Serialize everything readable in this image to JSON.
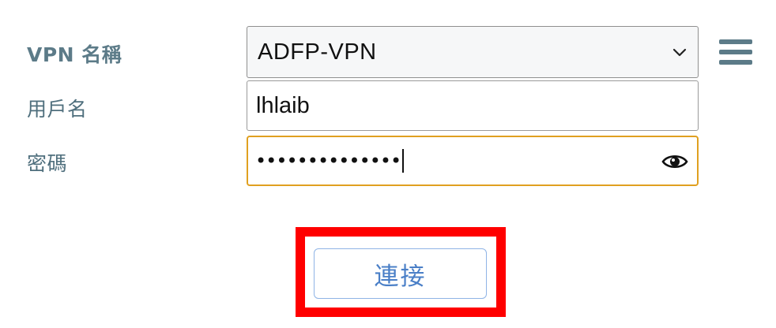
{
  "form": {
    "vpn_name_label": "VPN 名稱",
    "username_label": "用戶名",
    "password_label": "密碼",
    "vpn_name_value": "ADFP-VPN",
    "username_value": "lhlaib",
    "password_masked": "••••••••••••••"
  },
  "actions": {
    "connect_label": "連接",
    "menu_icon": "hamburger-menu-icon",
    "toggle_visibility_icon": "eye-icon",
    "dropdown_icon": "chevron-down-icon"
  },
  "colors": {
    "label": "#5c7b88",
    "focus_border": "#e0a020",
    "button_text": "#4a7fc7",
    "highlight": "#ff0000"
  }
}
